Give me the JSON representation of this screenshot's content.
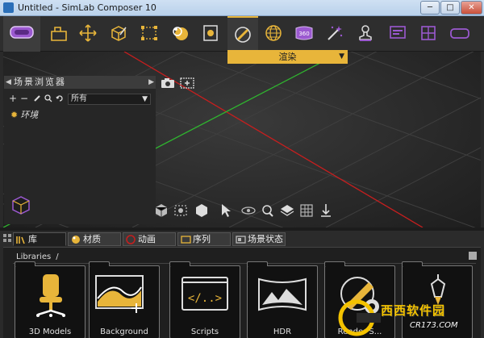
{
  "window": {
    "title": "Untitled - SimLab Composer 10",
    "min": "─",
    "max": "□",
    "close": "✕"
  },
  "toolbar": {
    "items": [
      {
        "name": "vr-headset-icon"
      },
      {
        "name": "open-icon"
      },
      {
        "name": "transform-icon"
      },
      {
        "name": "material-box-icon"
      },
      {
        "name": "select-region-icon"
      },
      {
        "name": "animation-icon"
      },
      {
        "name": "camera-doc-icon"
      },
      {
        "name": "render-icon"
      },
      {
        "name": "globe-icon"
      },
      {
        "name": "360-icon"
      },
      {
        "name": "magic-wand-icon"
      },
      {
        "name": "stamp-icon"
      },
      {
        "name": "presentation-icon"
      },
      {
        "name": "grid-layout-icon"
      },
      {
        "name": "vr-goggles-icon"
      }
    ],
    "first_dropdown": "▼",
    "render_dropdown_label": "渲染",
    "render_dropdown_arrow": "▼"
  },
  "scene_browser": {
    "title": "场景浏览器",
    "collapse": "◀",
    "expand": "▶",
    "add": "+",
    "remove": "−",
    "filter_value": "所有",
    "filter_arrow": "▼",
    "tree": [
      {
        "icon": "sun-icon",
        "label": "环境"
      }
    ]
  },
  "bottom_tabs": [
    {
      "label": "库",
      "icon": "library-icon"
    },
    {
      "label": "材质",
      "icon": "material-icon"
    },
    {
      "label": "动画",
      "icon": "animation-icon"
    },
    {
      "label": "序列",
      "icon": "sequence-icon"
    },
    {
      "label": "场景状态",
      "icon": "scene-state-icon"
    }
  ],
  "library": {
    "breadcrumb": "Libraries",
    "breadcrumb_sep": "/",
    "cards": [
      {
        "label": "3D Models",
        "icon": "chair-icon"
      },
      {
        "label": "Background",
        "icon": "background-icon"
      },
      {
        "label": "Scripts",
        "icon": "scripts-icon"
      },
      {
        "label": "HDR",
        "icon": "hdr-icon"
      },
      {
        "label": "Render S...",
        "icon": "render-settings-icon"
      },
      {
        "label": "",
        "icon": "light-icon"
      }
    ]
  },
  "watermark": {
    "brand": "西西软件园",
    "url": "CR173.COM"
  },
  "colors": {
    "accent": "#e8b53a",
    "panel": "#2e2e2e",
    "viewport": "#2a2a2a",
    "axis_x": "#c81e1e",
    "axis_y": "#2fb52f"
  }
}
